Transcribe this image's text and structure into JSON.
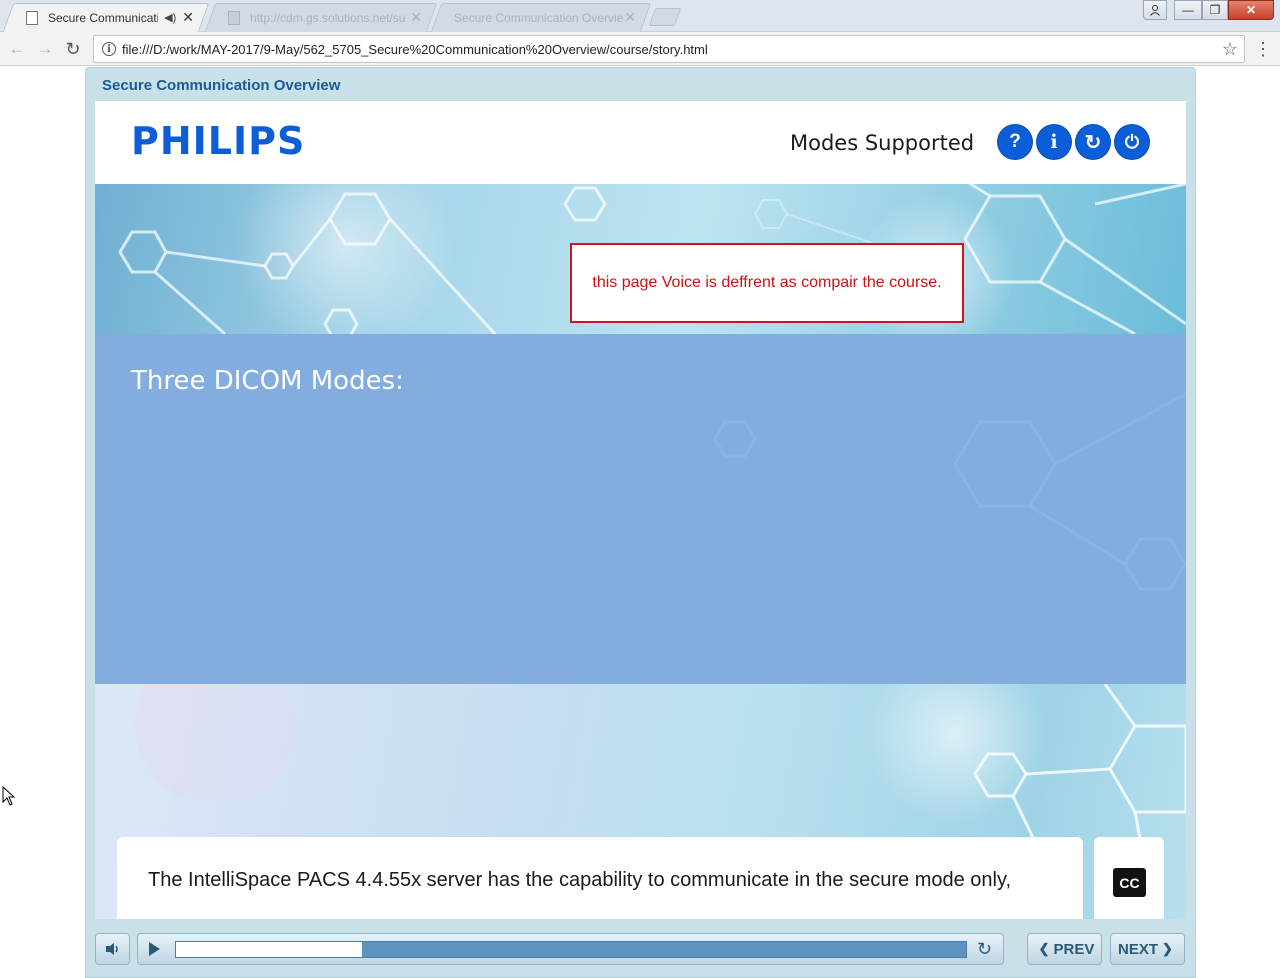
{
  "browser": {
    "tabs": [
      {
        "label": "Secure Communicatio",
        "active": true
      },
      {
        "label": "http://cdm.gs.solutions.net/su",
        "active": false
      },
      {
        "label": "Secure Communication Overvie",
        "active": false
      }
    ],
    "url": "file:///D:/work/MAY-2017/9-May/562_5705_Secure%20Communication%20Overview/course/story.html"
  },
  "player": {
    "course_title": "Secure Communication Overview"
  },
  "slide": {
    "logo": "PHILIPS",
    "title": "Modes Supported",
    "header_buttons": [
      {
        "name": "help",
        "glyph": "?"
      },
      {
        "name": "info",
        "glyph": "i"
      },
      {
        "name": "replay",
        "glyph": "↻"
      },
      {
        "name": "exit",
        "glyph": "⏻"
      }
    ],
    "review_note": "this page Voice is deffrent as compair the course.",
    "heading": "Three DICOM Modes:",
    "caption": "The IntelliSpace PACS 4.4.55x server has the capability to communicate in the secure mode only,",
    "cc_label": "CC"
  },
  "controls": {
    "progress_fraction": 0.236,
    "prev_label": "PREV",
    "next_label": "NEXT"
  },
  "colors": {
    "brand_blue": "#0b5ed7",
    "panel_blue": "#83addf",
    "note_red": "#d0141d",
    "title_blue": "#1b5c96"
  }
}
